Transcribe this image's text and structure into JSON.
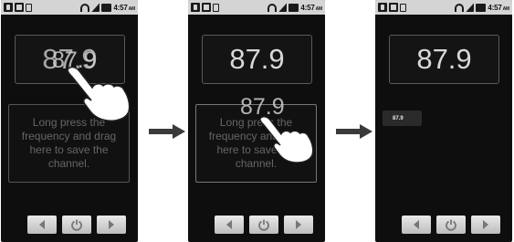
{
  "status_bar": {
    "time": "4:57",
    "ampm": "AM"
  },
  "screens": [
    {
      "frequency": "87.9",
      "dragging_frequency": "87.9",
      "drop_hint": "Long press the frequency and drag here to save the channel."
    },
    {
      "frequency": "87.9",
      "dragging_frequency": "87.9",
      "drop_hint": "Long press the frequency and drag here to save the channel."
    },
    {
      "frequency": "87.9",
      "saved_channel": "87.9"
    }
  ],
  "icons": {
    "status": [
      "usb-icon",
      "picture-icon",
      "sd-card-icon",
      "headphones-icon",
      "signal-icon",
      "battery-icon"
    ],
    "controls": [
      "previous-icon",
      "power-icon",
      "next-icon"
    ],
    "step_arrow": "right-arrow-icon",
    "gesture": "hand-pointer-icon"
  },
  "colors": {
    "screen_bg": "#0e0e0e",
    "status_bar": "#d4d4d4",
    "button": "#d6d6d6",
    "arrow": "#3a3a3a"
  }
}
